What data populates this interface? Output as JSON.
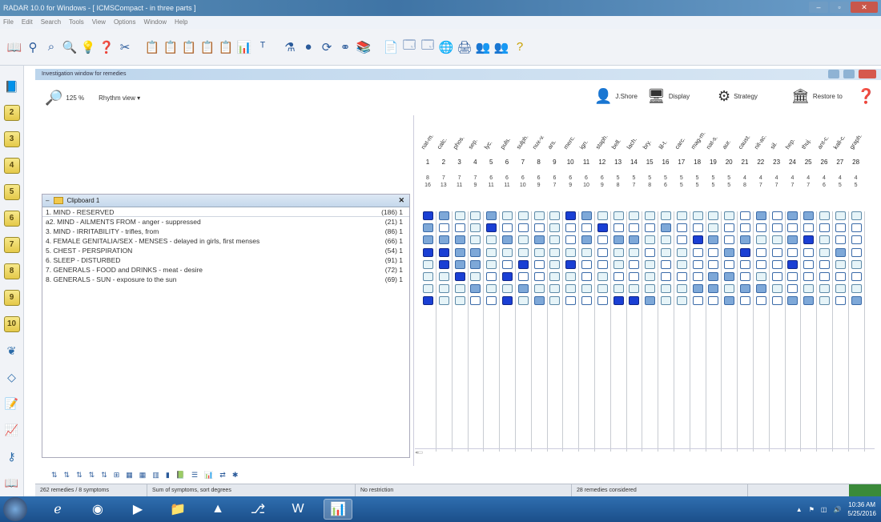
{
  "window": {
    "title": "RADAR 10.0 for Windows - [ ICMSCompact - in three parts ]"
  },
  "menu": [
    "File",
    "Edit",
    "Search",
    "Tools",
    "View",
    "Options",
    "Window",
    "Help"
  ],
  "subwindow": {
    "title": "Investigation window for remedies"
  },
  "view": {
    "zoom": "125 %",
    "mode": "Rhythm view"
  },
  "right_buttons": [
    {
      "label": "J.Shore",
      "icon": "person-icon"
    },
    {
      "label": "Display",
      "icon": "display-icon"
    },
    {
      "label": "Strategy",
      "icon": "gear-icon"
    },
    {
      "label": "Restore to",
      "icon": "building-icon"
    }
  ],
  "clipboard": {
    "title": "Clipboard 1",
    "symptoms": [
      {
        "text": "1. MIND - RESERVED",
        "count": "(186) 1"
      },
      {
        "text": "a2. MIND - AILMENTS FROM - anger - suppressed",
        "count": "(21) 1"
      },
      {
        "text": "3. MIND - IRRITABILITY - trifles, from",
        "count": "(86) 1"
      },
      {
        "text": "4. FEMALE GENITALIA/SEX - MENSES - delayed in girls, first menses",
        "count": "(66) 1"
      },
      {
        "text": "5. CHEST - PERSPIRATION",
        "count": "(54) 1"
      },
      {
        "text": "6. SLEEP - DISTURBED",
        "count": "(91) 1"
      },
      {
        "text": "7. GENERALS - FOOD and DRINKS - meat - desire",
        "count": "(72) 1"
      },
      {
        "text": "8. GENERALS - SUN - exposure to the sun",
        "count": "(69) 1"
      }
    ]
  },
  "remedies": {
    "names": [
      "nat-m.",
      "calc.",
      "phos.",
      "sep.",
      "lyc.",
      "puls.",
      "sulph.",
      "nux-v.",
      "ars.",
      "merc.",
      "ign.",
      "staph.",
      "bell.",
      "lach.",
      "bry.",
      "lil-t.",
      "carc.",
      "mag-m.",
      "nat-s.",
      "aur.",
      "caust.",
      "nit-ac.",
      "sil.",
      "hep.",
      "thuj.",
      "ant-c.",
      "kali-c.",
      "graph."
    ],
    "numbers": [
      "1",
      "2",
      "3",
      "4",
      "5",
      "6",
      "7",
      "8",
      "9",
      "10",
      "11",
      "12",
      "13",
      "14",
      "15",
      "16",
      "17",
      "18",
      "19",
      "20",
      "21",
      "22",
      "23",
      "24",
      "25",
      "26",
      "27",
      "28"
    ],
    "sums": [
      [
        "8",
        "16"
      ],
      [
        "7",
        "13"
      ],
      [
        "7",
        "11"
      ],
      [
        "7",
        "9"
      ],
      [
        "6",
        "11"
      ],
      [
        "6",
        "11"
      ],
      [
        "6",
        "10"
      ],
      [
        "6",
        "9"
      ],
      [
        "6",
        "7"
      ],
      [
        "6",
        "9"
      ],
      [
        "6",
        "10"
      ],
      [
        "6",
        "9"
      ],
      [
        "5",
        "8"
      ],
      [
        "5",
        "7"
      ],
      [
        "5",
        "8"
      ],
      [
        "5",
        "6"
      ],
      [
        "5",
        "5"
      ],
      [
        "5",
        "5"
      ],
      [
        "5",
        "5"
      ],
      [
        "5",
        "5"
      ],
      [
        "4",
        "8"
      ],
      [
        "4",
        "7"
      ],
      [
        "4",
        "7"
      ],
      [
        "4",
        "7"
      ],
      [
        "4",
        "7"
      ],
      [
        "4",
        "6"
      ],
      [
        "4",
        "5"
      ],
      [
        "4",
        "5"
      ]
    ]
  },
  "grid": [
    [
      3,
      2,
      1,
      1,
      2,
      1,
      1,
      1,
      1,
      3,
      2,
      1,
      1,
      1,
      1,
      1,
      1,
      1,
      1,
      1,
      0,
      2,
      0,
      2,
      2,
      1,
      1,
      1
    ],
    [
      2,
      0,
      0,
      1,
      3,
      0,
      0,
      0,
      1,
      0,
      0,
      3,
      0,
      0,
      0,
      2,
      0,
      0,
      1,
      0,
      0,
      0,
      0,
      0,
      0,
      0,
      0,
      0
    ],
    [
      2,
      2,
      2,
      1,
      1,
      2,
      1,
      2,
      1,
      0,
      2,
      0,
      2,
      2,
      1,
      1,
      0,
      3,
      2,
      0,
      2,
      1,
      1,
      2,
      3,
      1,
      0,
      0
    ],
    [
      3,
      3,
      2,
      2,
      1,
      1,
      1,
      1,
      1,
      1,
      1,
      0,
      1,
      1,
      0,
      1,
      1,
      0,
      0,
      2,
      3,
      0,
      0,
      0,
      0,
      1,
      2,
      0
    ],
    [
      1,
      3,
      2,
      2,
      1,
      0,
      3,
      0,
      1,
      3,
      0,
      0,
      1,
      0,
      1,
      0,
      1,
      0,
      0,
      0,
      0,
      0,
      0,
      3,
      0,
      0,
      1,
      1
    ],
    [
      1,
      1,
      3,
      1,
      0,
      3,
      0,
      0,
      1,
      1,
      0,
      1,
      0,
      0,
      1,
      0,
      0,
      0,
      2,
      2,
      0,
      1,
      0,
      0,
      0,
      0,
      0,
      0
    ],
    [
      1,
      1,
      1,
      2,
      1,
      1,
      2,
      1,
      1,
      1,
      1,
      1,
      1,
      1,
      1,
      1,
      1,
      2,
      2,
      1,
      2,
      2,
      1,
      0,
      1,
      1,
      1,
      1
    ],
    [
      3,
      1,
      1,
      0,
      0,
      3,
      1,
      2,
      1,
      0,
      0,
      0,
      3,
      3,
      2,
      1,
      1,
      0,
      0,
      2,
      0,
      0,
      0,
      2,
      2,
      1,
      0,
      2
    ]
  ],
  "status": {
    "remedies": "262 remedies / 8 symptoms",
    "sort": "Sum of symptoms, sort degrees",
    "restriction": "No restriction",
    "considered": "28 remedies considered"
  },
  "taskbar": {
    "time": "10:36 AM",
    "date": "5/25/2016"
  }
}
